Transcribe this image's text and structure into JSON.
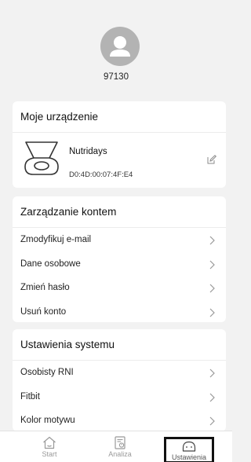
{
  "profile": {
    "user_id": "97130"
  },
  "device_section": {
    "title": "Moje urządzenie",
    "device_name": "Nutridays",
    "device_mac": "D0:4D:00:07:4F:E4"
  },
  "account_section": {
    "title": "Zarządzanie kontem",
    "items": [
      {
        "label": "Zmodyfikuj e-mail"
      },
      {
        "label": "Dane osobowe"
      },
      {
        "label": "Zmień hasło"
      },
      {
        "label": "Usuń konto"
      }
    ]
  },
  "system_section": {
    "title": "Ustawienia systemu",
    "items": [
      {
        "label": "Osobisty RNI"
      },
      {
        "label": "Fitbit"
      },
      {
        "label": "Kolor motywu"
      }
    ]
  },
  "tabs": [
    {
      "label": "Start",
      "icon": "home-icon"
    },
    {
      "label": "Analiza",
      "icon": "analysis-icon"
    },
    {
      "label": "Ustawienia",
      "icon": "settings-face-icon",
      "active": true
    }
  ],
  "colors": {
    "background": "#f2f2f2",
    "avatar": "#b3b3b3",
    "inactive_tab": "#9a9a9a"
  }
}
